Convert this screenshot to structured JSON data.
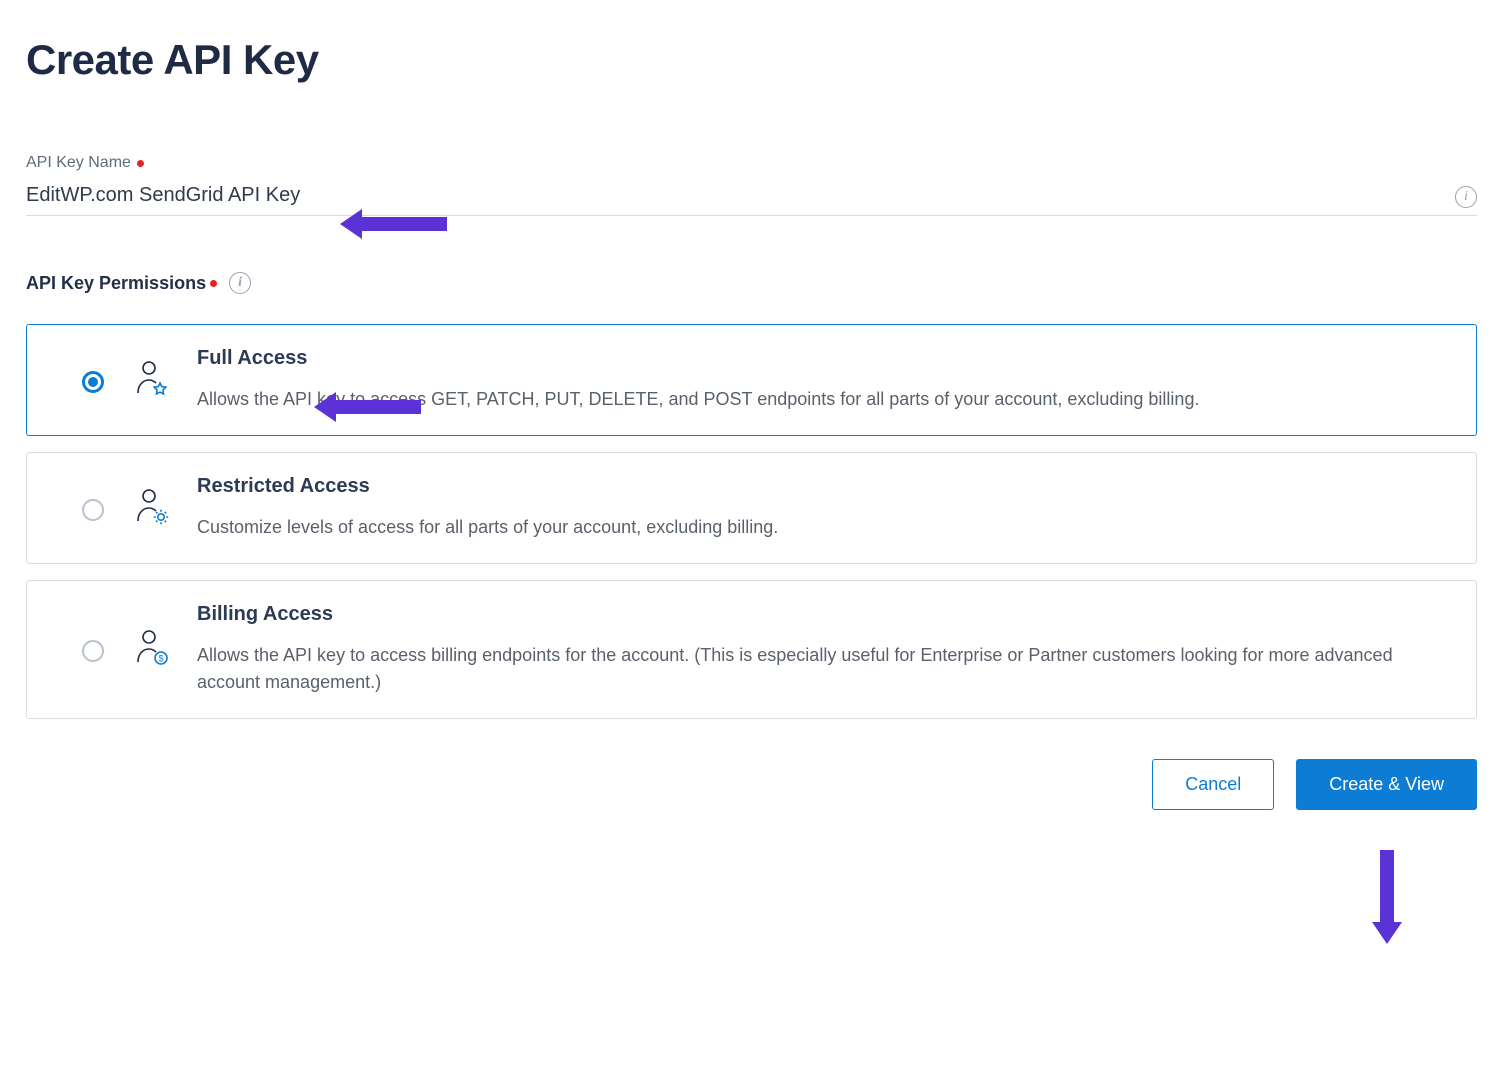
{
  "page": {
    "title": "Create API Key"
  },
  "name_field": {
    "label": "API Key Name",
    "value": "EditWP.com SendGrid API Key"
  },
  "permissions": {
    "label": "API Key Permissions",
    "options": [
      {
        "id": "full",
        "title": "Full Access",
        "description": "Allows the API key to access GET, PATCH, PUT, DELETE, and POST endpoints for all parts of your account, excluding billing.",
        "selected": true
      },
      {
        "id": "restricted",
        "title": "Restricted Access",
        "description": "Customize levels of access for all parts of your account, excluding billing.",
        "selected": false
      },
      {
        "id": "billing",
        "title": "Billing Access",
        "description": "Allows the API key to access billing endpoints for the account. (This is especially useful for Enterprise or Partner customers looking for more advanced account management.)",
        "selected": false
      }
    ]
  },
  "buttons": {
    "cancel": "Cancel",
    "submit": "Create & View"
  }
}
